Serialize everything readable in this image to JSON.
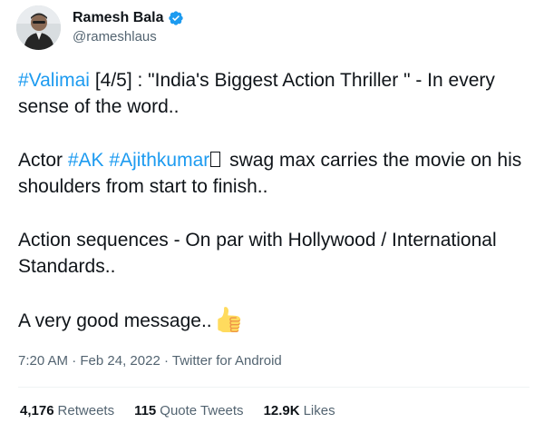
{
  "author": {
    "display_name": "Ramesh Bala",
    "handle": "@rameshlaus",
    "verified": true
  },
  "tweet": {
    "line1": {
      "hashtag": "#Valimai",
      "text": " [4/5] : \"India's Biggest Action Thriller \" - In every sense of the word.."
    },
    "line2": {
      "prefix": "Actor ",
      "hashtag1": "#AK",
      "hashtag2": "#Ajithkumar",
      "suffix": " swag max carries the movie on his shoulders from start to finish.."
    },
    "line3": "Action sequences - On par with Hollywood / International Standards..",
    "line4": "A very good message..",
    "emoji": "thumbs-up-icon"
  },
  "meta": {
    "time": "7:20 AM",
    "separator1": " · ",
    "date": "Feb 24, 2022",
    "separator2": " · ",
    "source": "Twitter for Android"
  },
  "stats": {
    "retweets": {
      "count": "4,176",
      "label": "Retweets"
    },
    "quotes": {
      "count": "115",
      "label": "Quote Tweets"
    },
    "likes": {
      "count": "12.9K",
      "label": "Likes"
    }
  },
  "colors": {
    "link": "#1d9bf0",
    "text": "#0f1419",
    "secondary": "#536471",
    "divider": "#eff3f4"
  }
}
